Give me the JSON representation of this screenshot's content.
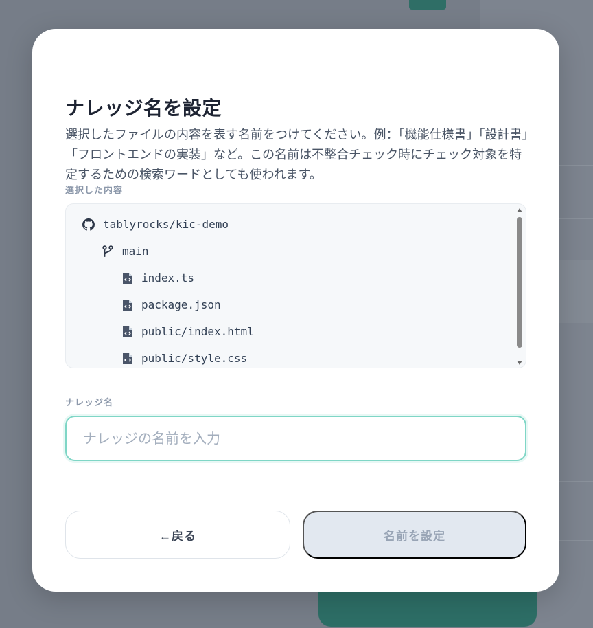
{
  "modal": {
    "title": "ナレッジ名を設定",
    "description": "選択したファイルの内容を表す名前をつけてください。例：「機能仕様書」「設計書」「フロントエンドの実装」など。この名前は不整合チェック時にチェック対象を特定するための検索ワードとしても使われます。",
    "selected_label": "選択した内容",
    "tree": {
      "repo": "tablyrocks/kic-demo",
      "branch": "main",
      "files": [
        "index.ts",
        "package.json",
        "public/index.html",
        "public/style.css"
      ]
    },
    "name_label": "ナレッジ名",
    "name_input": {
      "value": "",
      "placeholder": "ナレッジの名前を入力"
    },
    "back_button": "←戻る",
    "set_button": "名前を設定"
  },
  "colors": {
    "accent_border": "#7fd6c6",
    "disabled_button": "#e2e8f0",
    "overlay": "#767d88"
  }
}
